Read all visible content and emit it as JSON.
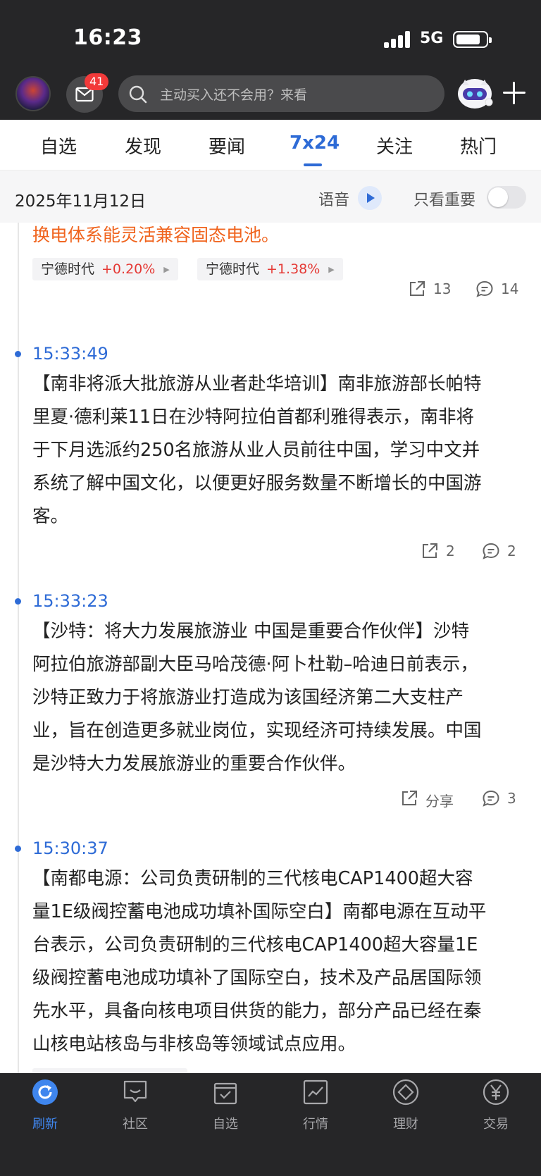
{
  "status_bar": {
    "time": "16:23",
    "network": "5G"
  },
  "header": {
    "mail_badge": "41",
    "search_placeholder": "主动买入还不会用？来看"
  },
  "tabs": [
    {
      "label": "自选"
    },
    {
      "label": "发现"
    },
    {
      "label": "要闻"
    },
    {
      "label": "7x24",
      "active": true
    },
    {
      "label": "关注"
    },
    {
      "label": "热门"
    }
  ],
  "date_bar": {
    "date": "2025年11月12日",
    "voice_label": "语音",
    "important_only_label": "只看重要",
    "important_only_on": false
  },
  "feed": {
    "partial_item": {
      "body_tail": "换电体系能灵活兼容固态电池。",
      "stocks": [
        {
          "name": "宁德时代",
          "change": "+0.20%"
        },
        {
          "name": "宁德时代",
          "change": "+1.38%"
        }
      ],
      "share_count": "13",
      "comment_count": "14"
    },
    "items": [
      {
        "time": "15:33:49",
        "lines": [
          "【南非将派大批旅游从业者赴华培训】南非旅游部长帕特",
          "里夏·德利莱11日在沙特阿拉伯首都利雅得表示，南非将",
          "于下月选派约250名旅游从业人员前往中国，学习中文并",
          "系统了解中国文化，以便更好服务数量不断增长的中国游",
          "客。"
        ],
        "share": "2",
        "comments": "2"
      },
      {
        "time": "15:33:23",
        "lines": [
          "【沙特：将大力发展旅游业 中国是重要合作伙伴】沙特",
          "阿拉伯旅游部副大臣马哈茂德·阿卜杜勒–哈迪日前表示，",
          "沙特正致力于将旅游业打造成为该国经济第二大支柱产",
          "业，旨在创造更多就业岗位，实现经济可持续发展。中国",
          "是沙特大力发展旅游业的重要合作伙伴。"
        ],
        "share": "分享",
        "comments": "3"
      },
      {
        "time": "15:30:37",
        "lines": [
          "【南都电源：公司负责研制的三代核电CAP1400超大容",
          "量1E级阀控蓄电池成功填补国际空白】南都电源在互动平",
          "台表示，公司负责研制的三代核电CAP1400超大容量1E",
          "级阀控蓄电池成功填补了国际空白，技术及产品居国际领",
          "先水平，具备向核电项目供货的能力，部分产品已经在秦",
          "山核电站核岛与非核岛等领域试点应用。"
        ]
      }
    ]
  },
  "bottom_nav": [
    {
      "label": "刷新",
      "icon": "refresh-icon",
      "active": true
    },
    {
      "label": "社区",
      "icon": "community-icon"
    },
    {
      "label": "自选",
      "icon": "watchlist-icon"
    },
    {
      "label": "行情",
      "icon": "market-chart-icon"
    },
    {
      "label": "理财",
      "icon": "wealth-icon"
    },
    {
      "label": "交易",
      "icon": "yen-icon"
    }
  ],
  "colors": {
    "accent_blue": "#2e6bd6",
    "up_red": "#e53935",
    "highlight_orange": "#f0641e",
    "header_bg": "#262628"
  }
}
